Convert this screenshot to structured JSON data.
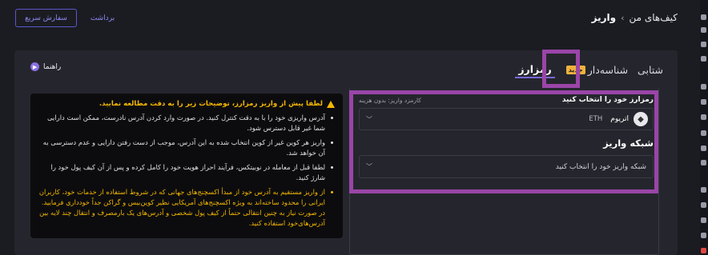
{
  "header": {
    "breadcrumb_home": "کیف‌های من",
    "breadcrumb_sep": "›",
    "breadcrumb_current": "واریز",
    "quick_order_label": "سفارش سریع",
    "withdraw_label": "برداشت"
  },
  "tabs": {
    "fiat": "شتابی",
    "id_deposit": "شناسه‌دار",
    "new_badge": "جدید",
    "crypto": "رمزارز"
  },
  "guide": {
    "label": "راهنما",
    "icon": "play-icon"
  },
  "notice": {
    "title": "لطفا پیش از واریز رمزارز، توضیحات زیر را به دقت مطالعه نمایید.",
    "items": [
      "آدرس واریزی خود را با به دقت کنترل کنید. در صورت وارد کردن آدرس نادرست، ممکن است دارایی شما غیر قابل دسترس شود.",
      "واریز هر کوین غیر از کوین انتخاب شده به این آدرس، موجب از دست رفتن دارایی و عدم دسترسی به آن خواهد شد.",
      "لطفا قبل از معامله در نوبیتکس، فرآیند احراز هویت خود را کامل کرده و پس از آن کیف پول خود را شارژ کنید."
    ],
    "warning_item": "از واریز مستقیم به آدرس خود از مبدأ اکسچنج‌های جهانی که در شروط استفاده از خدمات خود، کاربران ایرانی را محدود ساخته‌اند به ویژه اکسچنج‌های آمریکایی نظیر کوین‌بیس و گراکن جداً خودداری فرمایید. در صورت نیاز به چنین انتقالی حتماً از کیف پول شخصی و آدرس‌های یک بارمصرف و انتقال چند لایه بین آدرس‌های‌خود استفاده کنید."
  },
  "form": {
    "select_crypto_label": "رمزارز خود را انتخاب کنید",
    "fee_note": "کارمزد واریز: بدون هزینه",
    "coin_name": "اتریوم",
    "coin_symbol": "ETH",
    "network_title": "شبکه واریز",
    "network_placeholder": "شبکه واریز خود را انتخاب کنید"
  },
  "colors": {
    "accent": "#7a66d8",
    "highlight": "#9a45a8",
    "warning": "#f5b800"
  }
}
